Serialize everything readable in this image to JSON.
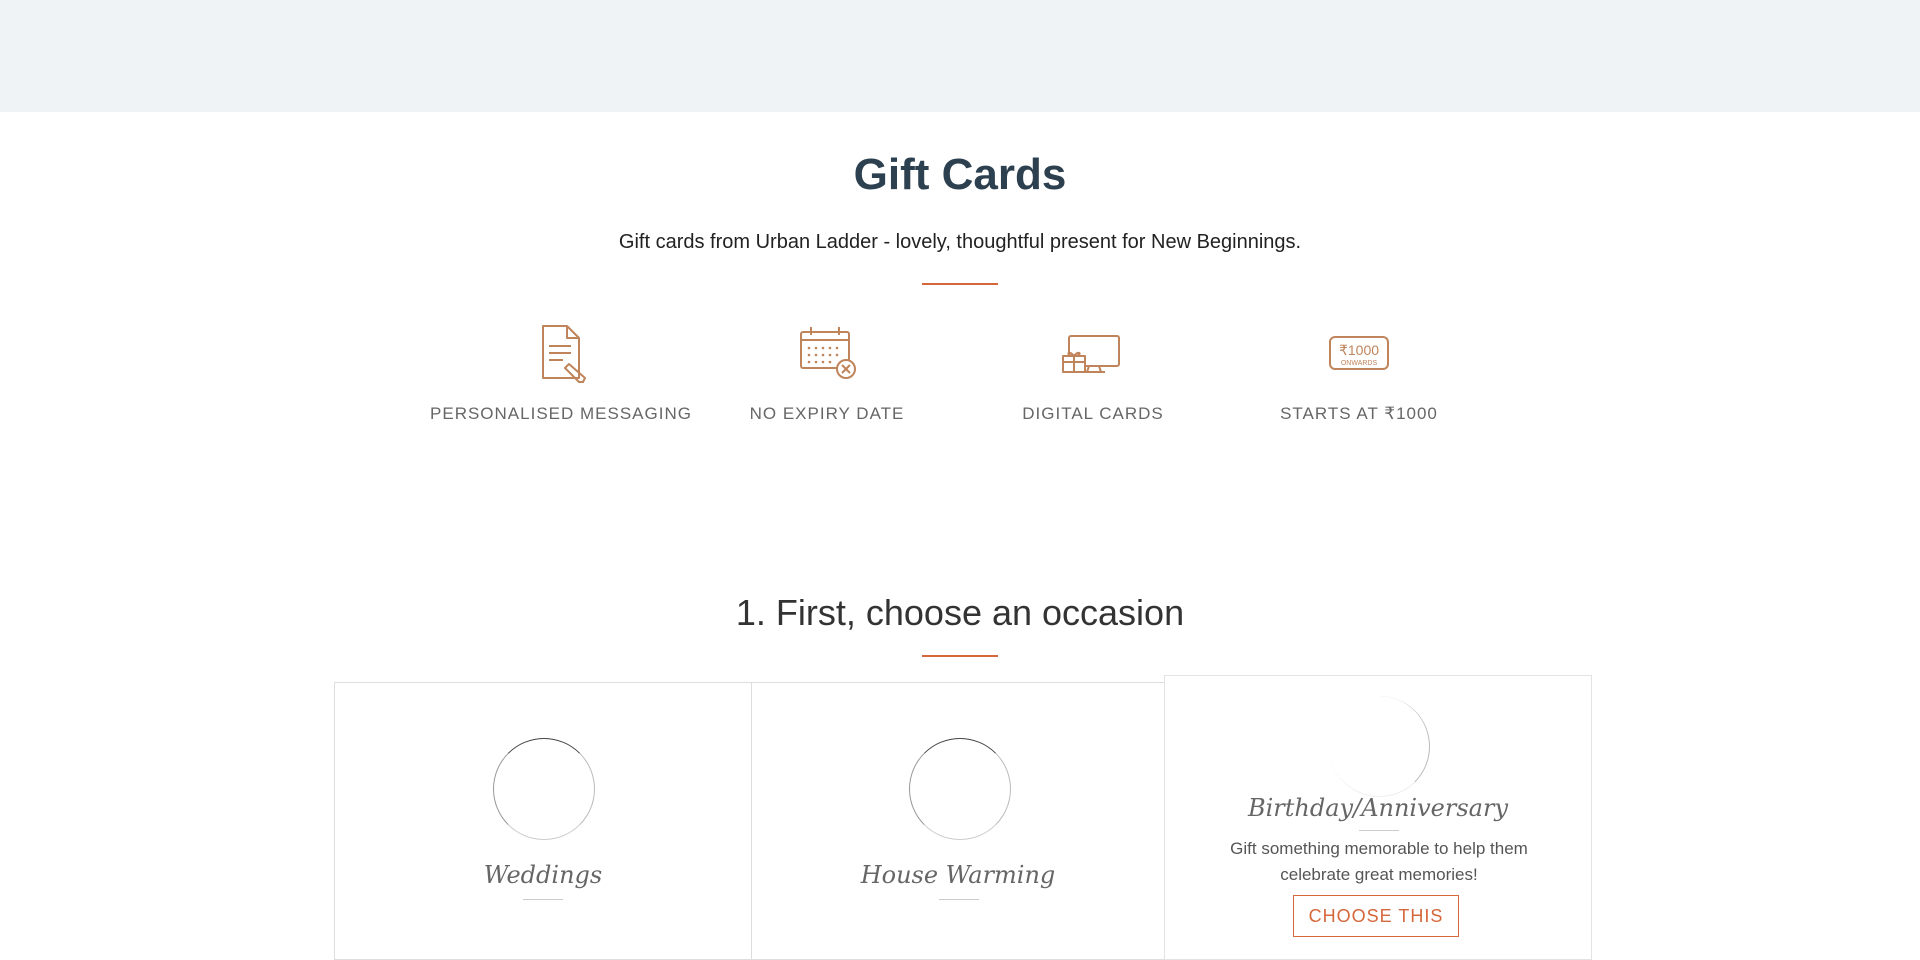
{
  "page": {
    "title": "Gift Cards",
    "subtitle": "Gift cards from Urban Ladder - lovely, thoughtful present for New Beginnings."
  },
  "features": [
    {
      "label": "PERSONALISED MESSAGING",
      "icon": "document-pen-icon"
    },
    {
      "label": "NO EXPIRY DATE",
      "icon": "calendar-cross-icon"
    },
    {
      "label": "DIGITAL CARDS",
      "icon": "monitor-gift-icon"
    },
    {
      "label": "STARTS AT ₹1000",
      "icon": "price-tag-icon",
      "icon_text": "₹1000",
      "icon_subtext": "ONWARDS"
    }
  ],
  "occasion": {
    "heading": "1. First, choose an occasion",
    "cards": [
      {
        "title": "Weddings"
      },
      {
        "title": "House Warming"
      },
      {
        "title": "Birthday/Anniversary",
        "description": "Gift something memorable to help them celebrate great memories!",
        "button": "CHOOSE THIS"
      }
    ]
  },
  "colors": {
    "accent": "#d4673b",
    "icon": "#c0845a",
    "heading": "#2c4050",
    "topbar": "#eff3f6"
  }
}
